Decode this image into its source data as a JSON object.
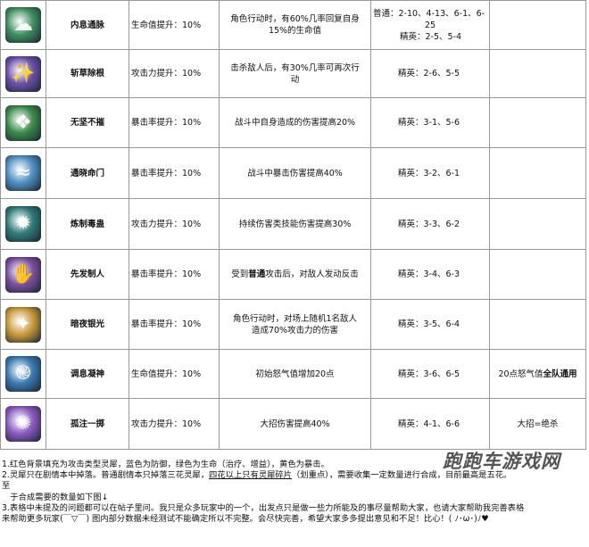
{
  "rows": [
    {
      "name": "内息通脉",
      "icon": "blue-cloud-icon",
      "color": "#3f8f5f",
      "effect": "生命值提升：10%",
      "desc_a": "角色行动时，有60%几率回复自身",
      "desc_b": "15%的生命值",
      "loc_a": "普通：2-10、4-13、6-1、6-",
      "loc_b": "25",
      "loc_c": "精英：2-5、5-4",
      "extra": ""
    },
    {
      "name": "斩草除根",
      "icon": "purple-claw-icon",
      "color": "#6a4fa8",
      "effect": "攻击力提升：10%",
      "desc_a": "击杀敌人后，有30%几率可再次行",
      "desc_b": "动",
      "loc_a": "",
      "loc_b": "",
      "loc_c": "精英：2-6、5-5",
      "extra": ""
    },
    {
      "name": "无坚不摧",
      "icon": "green-shield-icon",
      "color": "#3b8a4a",
      "effect": "暴击率提升：10%",
      "desc_a": "战斗中自身造成的伤害提高20%",
      "desc_b": "",
      "loc_a": "",
      "loc_b": "",
      "loc_c": "精英：3-1、5-6",
      "extra": ""
    },
    {
      "name": "通晓命门",
      "icon": "blue-wind-icon",
      "color": "#4f8fc0",
      "effect": "暴击率提升：10%",
      "desc_a": "战斗中暴击伤害提高40%",
      "desc_b": "",
      "loc_a": "",
      "loc_b": "",
      "loc_c": "精英：3-2、6-1",
      "extra": ""
    },
    {
      "name": "炼制毒蛊",
      "icon": "teal-beetle-icon",
      "color": "#2f7a78",
      "effect": "攻击力提升：10%",
      "desc_a": "持续伤害类技能伤害提高30%",
      "desc_b": "",
      "loc_a": "",
      "loc_b": "",
      "loc_c": "精英：3-3、6-2",
      "extra": ""
    },
    {
      "name": "先发制人",
      "icon": "purple-hand-icon",
      "color": "#7a4fa0",
      "effect": "暴击率提升：10%",
      "desc_pre": "受到",
      "desc_bold": "普通",
      "desc_post": "攻击后，对敌人发动反击",
      "loc_a": "",
      "loc_b": "",
      "loc_c": "精英：3-4、6-3",
      "extra": ""
    },
    {
      "name": "暗夜银光",
      "icon": "gold-star-icon",
      "color": "#c99a3a",
      "effect": "暴击率提升：10%",
      "desc_a": "角色行动时，对场上随机1名敌人",
      "desc_b": "造成70%攻击力的伤害",
      "loc_a": "",
      "loc_b": "",
      "loc_c": "精英：3-5、6-4",
      "extra": ""
    },
    {
      "name": "调息凝神",
      "icon": "blue-swirl-icon",
      "color": "#3a78b0",
      "effect": "生命值提升：10%",
      "desc_a": "初始怒气值增加20点",
      "desc_b": "",
      "loc_a": "",
      "loc_b": "",
      "loc_c": "精英：3-6、6-5",
      "extra_pre": "20点怒气值",
      "extra_bold": "全队通用"
    },
    {
      "name": "孤注一掷",
      "icon": "purple-burst-icon",
      "color": "#8a5ac0",
      "effect": "攻击力提升：10%",
      "desc_a": "大招伤害提高40%",
      "desc_b": "",
      "loc_a": "",
      "loc_b": "",
      "loc_c": "精英：4-1、6-6",
      "extra": "大招=绝杀"
    }
  ],
  "notes": {
    "n1": "1.红色背景填充为攻击类型灵犀，蓝色为防御，绿色为生命（治疗、增益），黄色为暴击。",
    "n2_a": "2.灵犀只在剧情本中掉落。普通剧情本只掉落三花灵犀，",
    "n2_u": "四花以上只有灵犀碎片",
    "n2_b": "（划重点），需要收集一定数量进行合成，目前最高是五花。",
    "n2_c": "至",
    "n2_d": "　于合成需要的数量如下图↓",
    "n3_a": "3.表格中未提及的问题都可以在帖子里问。我只是众多玩家中的一个，出发点只是做一些力所能及的事尽量帮助大家，也请大家帮助我完善表格",
    "n3_b": "来帮助更多玩家(￣▽￣) 图内部分数据未经测试不能确定所以不完整。会尽快完善，希望大家多多提出意见和不足！比心！( ﾉ･ω･)ﾉ♥"
  },
  "watermark": "跑跑车游戏网"
}
